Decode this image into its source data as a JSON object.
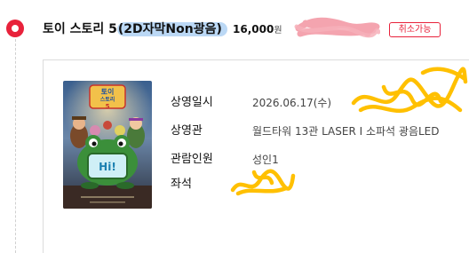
{
  "booking": {
    "title_main": "토이 스토리 5",
    "title_format": "(2D자막Non광음)",
    "price_amount": "16,000",
    "price_unit": "원",
    "cancel_label": "취소가능"
  },
  "details": {
    "date_label": "상영일시",
    "date_value": "2026.06.17(수)",
    "theater_label": "상영관",
    "theater_value": "월드타워 13관 LASER I 소파석 광음LED",
    "audience_label": "관람인원",
    "audience_value": "성인1",
    "seat_label": "좌석",
    "seat_value": ""
  },
  "poster": {
    "logo_line1": "토이",
    "logo_line2": "스토리",
    "logo_number": "5",
    "screen_text": "Hi!"
  },
  "colors": {
    "accent": "#e8223b",
    "highlight": "#96c3f0",
    "pink_redaction": "#f39aa6",
    "scribble": "#ffc000"
  }
}
